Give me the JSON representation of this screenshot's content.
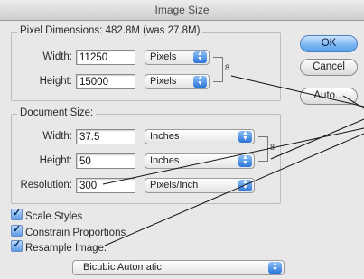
{
  "dialog": {
    "title": "Image Size"
  },
  "pixel_dimensions": {
    "legend": "Pixel Dimensions:  482.8M (was 27.8M)",
    "width_label": "Width:",
    "width_value": "11250",
    "width_unit": "Pixels",
    "height_label": "Height:",
    "height_value": "15000",
    "height_unit": "Pixels"
  },
  "document_size": {
    "legend": "Document Size:",
    "width_label": "Width:",
    "width_value": "37.5",
    "width_unit": "Inches",
    "height_label": "Height:",
    "height_value": "50",
    "height_unit": "Inches",
    "resolution_label": "Resolution:",
    "resolution_value": "300",
    "resolution_unit": "Pixels/Inch"
  },
  "options": {
    "scale_styles": "Scale Styles",
    "constrain_proportions": "Constrain Proportions",
    "resample_image": "Resample Image:",
    "resample_method": "Bicubic Automatic"
  },
  "buttons": {
    "ok": "OK",
    "cancel": "Cancel",
    "auto": "Auto..."
  },
  "icons": {
    "link": "chain-link-icon",
    "popup": "popup-arrows-icon"
  },
  "colors": {
    "accent": "#5aa0ec",
    "background": "#e8e8e8"
  }
}
